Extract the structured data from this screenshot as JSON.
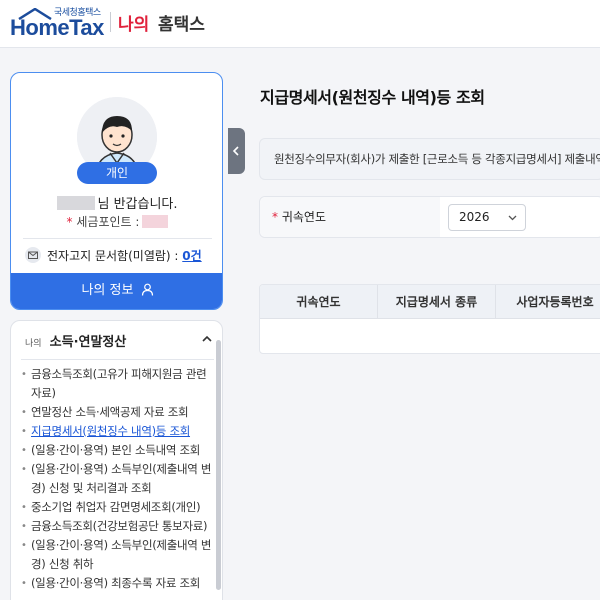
{
  "header": {
    "logo_sub": "국세청홈택스",
    "logo_text": "HomeTax",
    "brand_my": "나의",
    "brand_hometax": "홈택스"
  },
  "profile": {
    "badge": "개인",
    "greeting_suffix": "님 반갑습니다.",
    "points_label": "세금포인트 :",
    "mailbox_label": "전자고지 문서함(미열람) :",
    "mailbox_count": "0건",
    "my_info_button": "나의 정보"
  },
  "menu": {
    "category_prefix": "나의",
    "category_title": "소득·연말정산",
    "items": [
      {
        "label": "금융소득조회(고유가 피해지원금 관련자료)",
        "active": false
      },
      {
        "label": "연말정산 소득·세액공제 자료 조회",
        "active": false
      },
      {
        "label": "지급명세서(원천징수 내역)등 조회",
        "active": true
      },
      {
        "label": "(일용·간이·용역) 본인 소득내역 조회",
        "active": false
      },
      {
        "label": "(일용·간이·용역) 소득부인(제출내역 변경) 신청 및 처리결과 조회",
        "active": false
      },
      {
        "label": "중소기업 취업자 감면명세조회(개인)",
        "active": false
      },
      {
        "label": "금융소득조회(건강보험공단 통보자료)",
        "active": false
      },
      {
        "label": "(일용·간이·용역) 소득부인(제출내역 변경) 신청 취하",
        "active": false
      },
      {
        "label": "(일용·간이·용역) 최종수록 자료 조회",
        "active": false
      }
    ]
  },
  "main": {
    "title": "지급명세서(원천징수 내역)등 조회",
    "notice": "원천징수의무자(회사)가 제출한 [근로소득 등 각종지급명세서] 제출내역",
    "filter": {
      "label": "귀속연도",
      "year": "2026"
    },
    "table": {
      "columns": [
        "귀속연도",
        "지급명세서 종류",
        "사업자등록번호"
      ]
    }
  },
  "colors": {
    "primary": "#2f6fe4",
    "brand_red": "#e0213b",
    "logo_blue": "#1c4c9c",
    "link_blue": "#1a56d6"
  }
}
